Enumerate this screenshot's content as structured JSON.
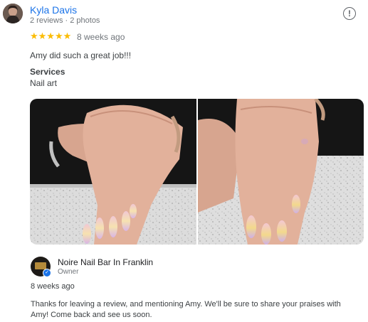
{
  "reviewer": {
    "name": "Kyla Davis",
    "meta": "2 reviews · 2 photos"
  },
  "review": {
    "stars": "★★★★★",
    "rating": 5,
    "time": "8 weeks ago",
    "text": "Amy did such a great job!!!",
    "services_title": "Services",
    "services_value": "Nail art"
  },
  "more_icon": "!",
  "owner": {
    "name": "Noire Nail Bar In Franklin",
    "role": "Owner",
    "time": "8 weeks ago",
    "reply": "Thanks for leaving a review, and mentioning Amy. We'll be sure to share your praises with Amy! Come back and see us soon."
  },
  "colors": {
    "name_link": "#1a73e8",
    "star": "#fbbc04",
    "muted": "#70757a"
  }
}
